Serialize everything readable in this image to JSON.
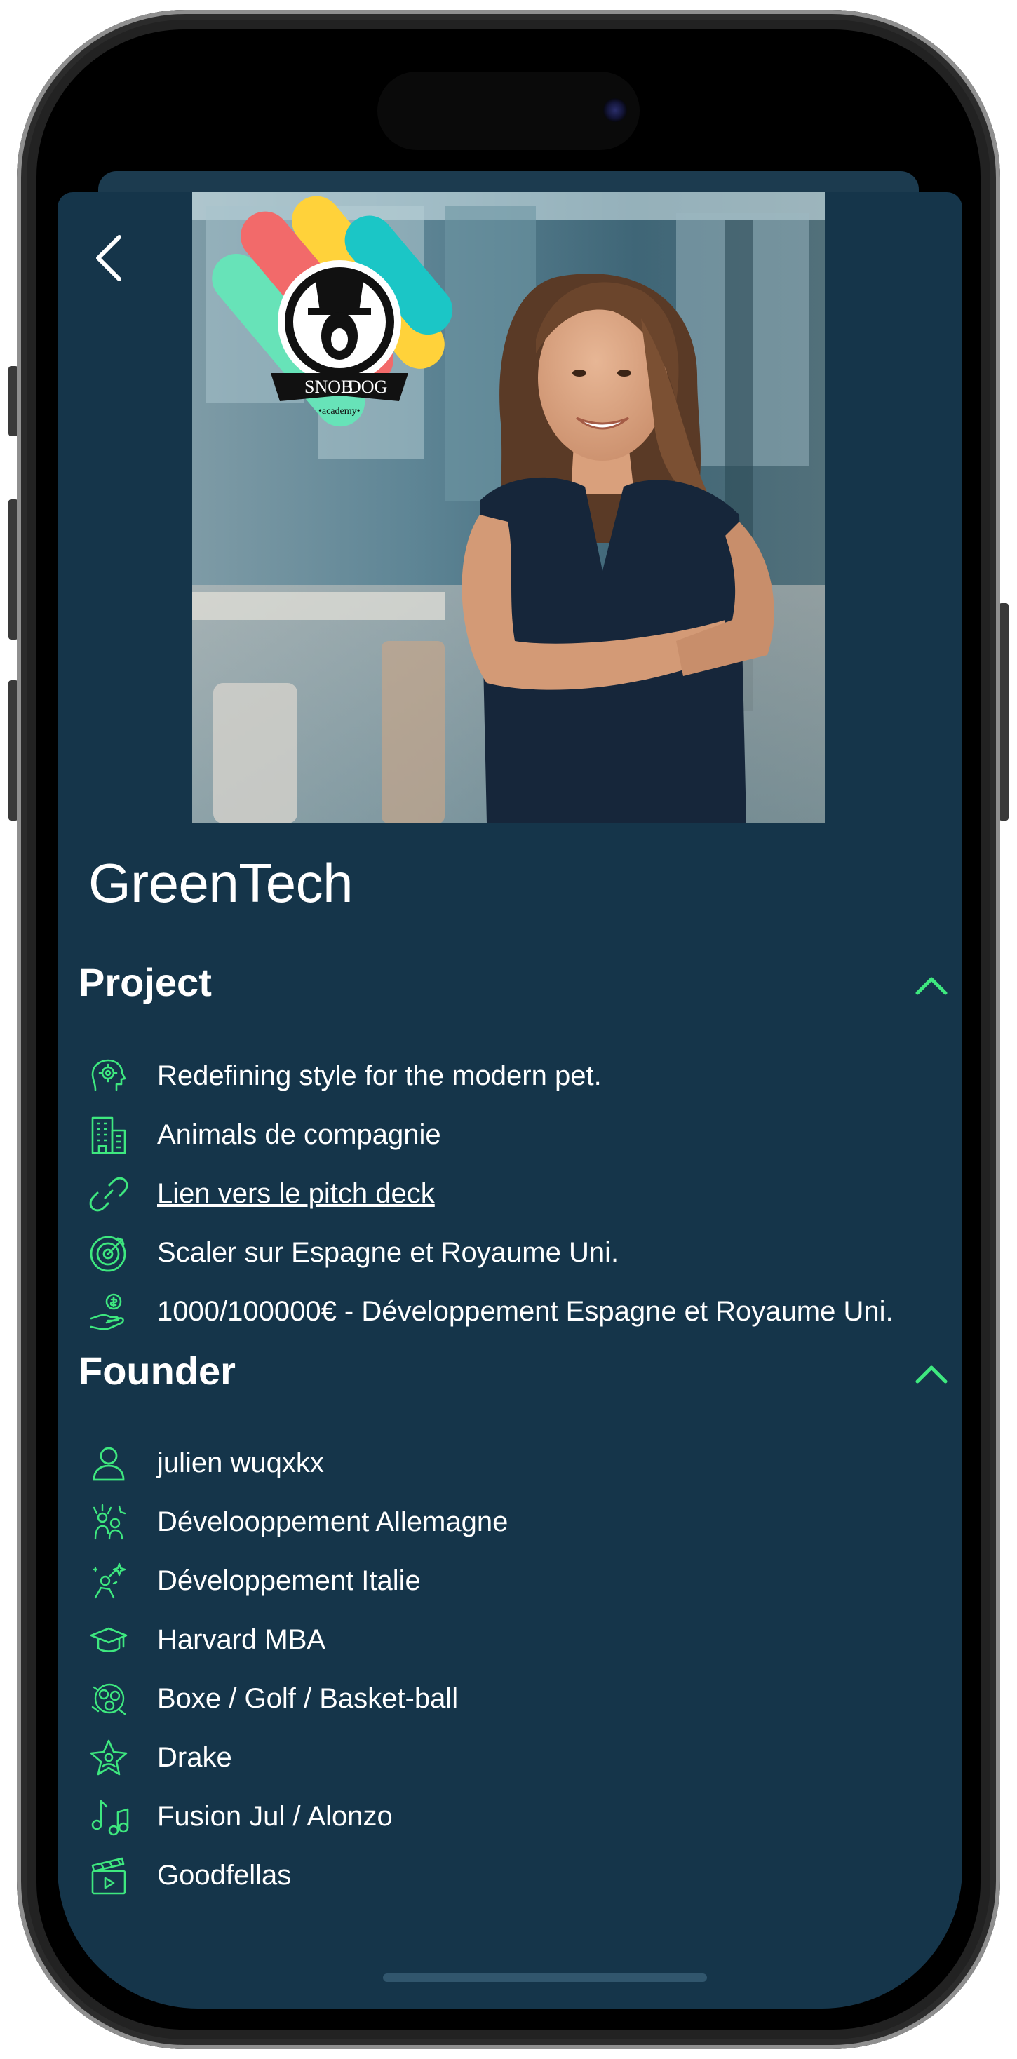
{
  "app": {
    "title": "GreenTech",
    "back_label": "Back"
  },
  "colors": {
    "background": "#15354a",
    "accent": "#3ee87f",
    "text": "#ffffff"
  },
  "hero": {
    "logo_text_left": "SNOB",
    "logo_text_right": "DOG",
    "logo_subtext": "•academy•"
  },
  "project": {
    "heading": "Project",
    "items": [
      {
        "icon": "idea-gear-icon",
        "text": "Redefining style for the modern pet."
      },
      {
        "icon": "building-icon",
        "text": "Animals de compagnie"
      },
      {
        "icon": "link-icon",
        "text": "Lien vers le pitch deck",
        "is_link": true
      },
      {
        "icon": "target-icon",
        "text": "Scaler sur Espagne et Royaume Uni."
      },
      {
        "icon": "money-hand-icon",
        "text": "1000/100000€ - Développement Espagne et Royaume Uni."
      }
    ]
  },
  "founder": {
    "heading": "Founder",
    "items": [
      {
        "icon": "person-icon",
        "text": "julien wuqxkx"
      },
      {
        "icon": "teamwork-icon",
        "text": "Dévelooppement Allemagne"
      },
      {
        "icon": "celebration-icon",
        "text": "Développement Italie"
      },
      {
        "icon": "graduation-cap-icon",
        "text": "Harvard MBA"
      },
      {
        "icon": "sports-icon",
        "text": "Boxe / Golf / Basket-ball"
      },
      {
        "icon": "star-person-icon",
        "text": "Drake"
      },
      {
        "icon": "music-note-icon",
        "text": "Fusion Jul / Alonzo"
      },
      {
        "icon": "clapperboard-icon",
        "text": "Goodfellas"
      }
    ]
  }
}
